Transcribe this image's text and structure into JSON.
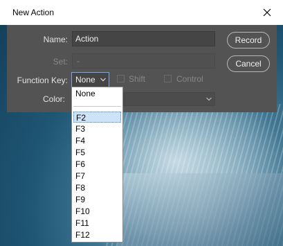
{
  "window": {
    "title": "New Action"
  },
  "form": {
    "name_label": "Name:",
    "name_value": "Action",
    "set_label": "Set:",
    "set_value": "-",
    "function_key_label": "Function Key:",
    "function_key_value": "None",
    "shift_label": "Shift",
    "control_label": "Control",
    "color_label": "Color:"
  },
  "buttons": {
    "record": "Record",
    "cancel": "Cancel"
  },
  "function_key_dropdown": {
    "top_option": "None",
    "options": [
      "F2",
      "F3",
      "F4",
      "F5",
      "F6",
      "F7",
      "F8",
      "F9",
      "F10",
      "F11",
      "F12"
    ],
    "selected": "F2"
  },
  "colors": {
    "dialog_bg": "#535353",
    "selection_bg": "#cde3f7",
    "focus_border": "#79a9e8"
  }
}
